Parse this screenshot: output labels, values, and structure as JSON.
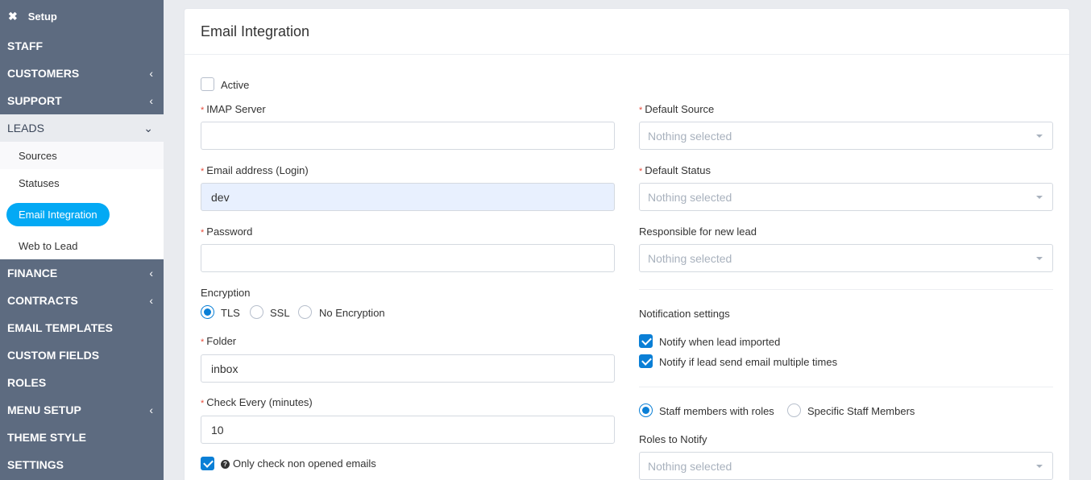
{
  "sidebar": {
    "header": "Setup",
    "items": [
      {
        "label": "STAFF",
        "chevron": false
      },
      {
        "label": "CUSTOMERS",
        "chevron": true
      },
      {
        "label": "SUPPORT",
        "chevron": true
      },
      {
        "label": "LEADS",
        "open": true
      }
    ],
    "leads_sub": [
      "Sources",
      "Statuses",
      "Email Integration",
      "Web to Lead"
    ],
    "items_after": [
      {
        "label": "FINANCE",
        "chevron": true
      },
      {
        "label": "CONTRACTS",
        "chevron": true
      },
      {
        "label": "EMAIL TEMPLATES",
        "chevron": false
      },
      {
        "label": "CUSTOM FIELDS",
        "chevron": false
      },
      {
        "label": "ROLES",
        "chevron": false
      },
      {
        "label": "MENU SETUP",
        "chevron": true
      },
      {
        "label": "THEME STYLE",
        "chevron": false
      },
      {
        "label": "SETTINGS",
        "chevron": false
      }
    ]
  },
  "panel": {
    "title": "Email Integration",
    "active_label": "Active",
    "imap_label": "IMAP Server",
    "imap_value": "",
    "email_label": "Email address (Login)",
    "email_value": "dev",
    "password_label": "Password",
    "password_value": "",
    "encryption_label": "Encryption",
    "encryption_options": [
      "TLS",
      "SSL",
      "No Encryption"
    ],
    "encryption_selected": "TLS",
    "folder_label": "Folder",
    "folder_value": "inbox",
    "check_every_label": "Check Every (minutes)",
    "check_every_value": "10",
    "only_non_opened_label": "Only check non opened emails",
    "default_source_label": "Default Source",
    "default_status_label": "Default Status",
    "responsible_label": "Responsible for new lead",
    "select_placeholder": "Nothing selected",
    "notification_label": "Notification settings",
    "notify_imported_label": "Notify when lead imported",
    "notify_multiple_label": "Notify if lead send email multiple times",
    "staff_roles_label": "Staff members with roles",
    "specific_staff_label": "Specific Staff Members",
    "roles_to_notify_label": "Roles to Notify"
  },
  "colors": {
    "sidebar": "#5d6b80",
    "accent": "#03a9f4",
    "checkbox": "#0a7fd6"
  }
}
